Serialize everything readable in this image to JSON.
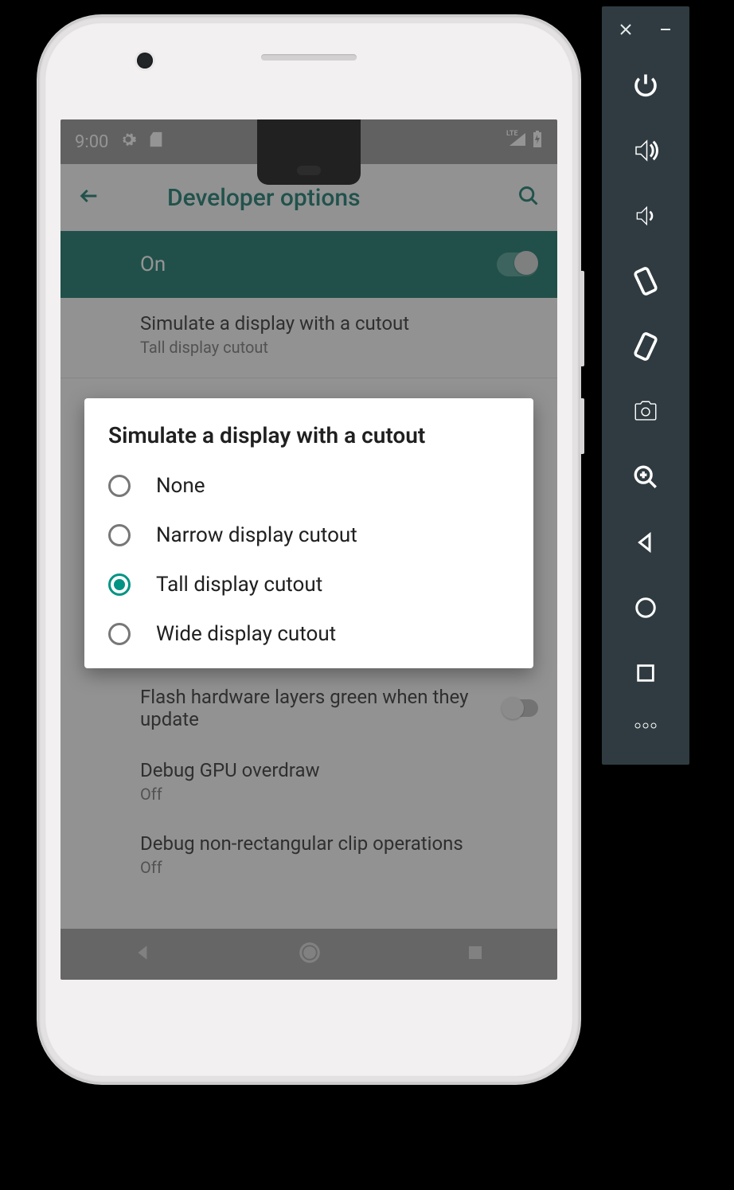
{
  "statusbar": {
    "time": "9:00",
    "net_label": "LTE"
  },
  "toolbar": {
    "title": "Developer options"
  },
  "master": {
    "label": "On",
    "enabled": true
  },
  "rows": {
    "cutout": {
      "title": "Simulate a display with a cutout",
      "subtitle": "Tall display cutout"
    },
    "hw": {
      "title": "Flash hardware layers green when they update",
      "subtitle": ""
    },
    "gpu": {
      "title": "Debug GPU overdraw",
      "subtitle": "Off"
    },
    "clip": {
      "title": "Debug non-rectangular clip operations",
      "subtitle": "Off"
    }
  },
  "dialog": {
    "title": "Simulate a display with a cutout",
    "options": [
      {
        "label": "None",
        "selected": false
      },
      {
        "label": "Narrow display cutout",
        "selected": false
      },
      {
        "label": "Tall display cutout",
        "selected": true
      },
      {
        "label": "Wide display cutout",
        "selected": false
      }
    ]
  },
  "sidebar": {
    "items": [
      "power",
      "volume-up",
      "volume-down",
      "rotate-left",
      "rotate-right",
      "screenshot",
      "zoom",
      "back",
      "home",
      "overview",
      "more"
    ]
  }
}
